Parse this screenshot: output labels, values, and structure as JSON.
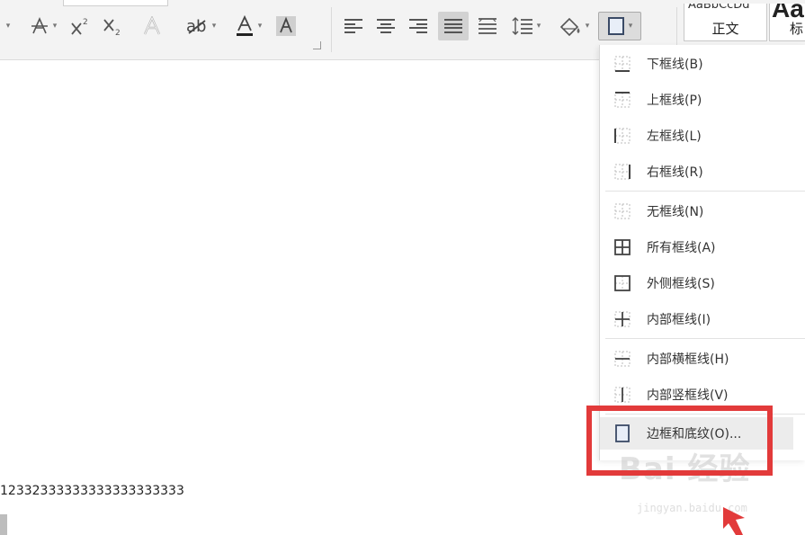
{
  "toolbar": {
    "font_group": {
      "strikethrough_icon": "strikethrough-icon",
      "superscript_icon": "superscript-icon",
      "subscript_icon": "subscript-icon",
      "text_effects_icon": "text-effects-icon",
      "highlight_icon": "highlight-icon",
      "font_color_icon": "font-color-icon",
      "char_shading_icon": "char-shading-icon"
    },
    "paragraph_group": {
      "align_left_icon": "align-left-icon",
      "align_center_icon": "align-center-icon",
      "align_right_icon": "align-right-icon",
      "justify_icon": "justify-icon",
      "distributed_icon": "distributed-icon",
      "line_spacing_icon": "line-spacing-icon",
      "shading_icon": "shading-icon",
      "borders_icon": "borders-icon"
    },
    "styles": [
      {
        "sample": "AaBbCcDd",
        "name": "正文"
      },
      {
        "sample": "Aa",
        "name": "标"
      }
    ]
  },
  "border_menu": {
    "items": [
      {
        "label": "下框线(B)",
        "icon": "bottom-border-icon"
      },
      {
        "label": "上框线(P)",
        "icon": "top-border-icon"
      },
      {
        "label": "左框线(L)",
        "icon": "left-border-icon"
      },
      {
        "label": "右框线(R)",
        "icon": "right-border-icon"
      },
      {
        "label": "无框线(N)",
        "icon": "no-border-icon"
      },
      {
        "label": "所有框线(A)",
        "icon": "all-borders-icon"
      },
      {
        "label": "外侧框线(S)",
        "icon": "outside-borders-icon"
      },
      {
        "label": "内部框线(I)",
        "icon": "inside-borders-icon"
      },
      {
        "label": "内部横框线(H)",
        "icon": "inside-horizontal-border-icon"
      },
      {
        "label": "内部竖框线(V)",
        "icon": "inside-vertical-border-icon"
      },
      {
        "label": "边框和底纹(O)...",
        "icon": "borders-and-shading-icon"
      }
    ]
  },
  "document": {
    "text_line": "12332333333333333333333"
  },
  "watermark": {
    "main": "Bai 经验",
    "sub": "jingyan.baidu.com"
  },
  "colors": {
    "highlight_frame": "#e23a3a",
    "ribbon_bg": "#f3f3f3"
  }
}
